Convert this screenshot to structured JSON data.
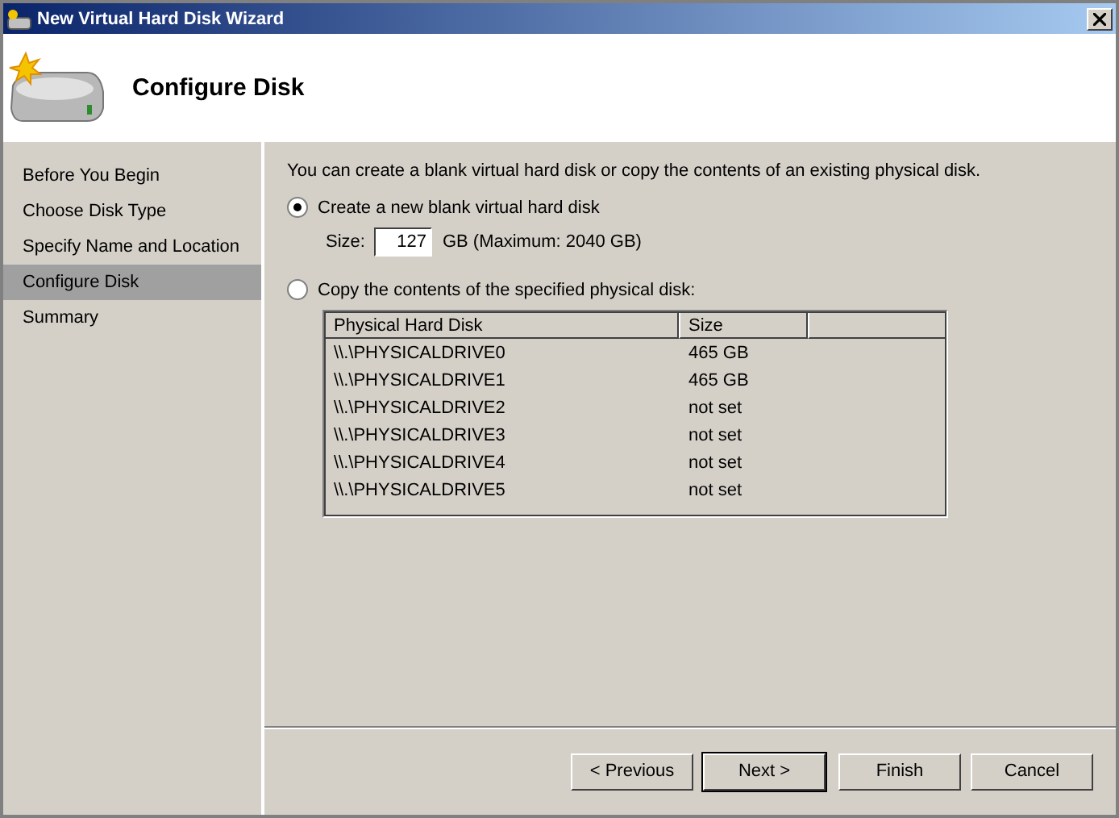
{
  "window": {
    "title": "New Virtual Hard Disk Wizard"
  },
  "header": {
    "title": "Configure Disk"
  },
  "sidebar": {
    "items": [
      {
        "label": "Before You Begin",
        "selected": false
      },
      {
        "label": "Choose Disk Type",
        "selected": false
      },
      {
        "label": "Specify Name and Location",
        "selected": false
      },
      {
        "label": "Configure Disk",
        "selected": true
      },
      {
        "label": "Summary",
        "selected": false
      }
    ]
  },
  "intro": "You can create a blank virtual hard disk or copy the contents of an existing physical disk.",
  "options": [
    {
      "label": "Create a new blank virtual hard disk",
      "selected": true
    },
    {
      "label": "Copy the contents of the specified physical disk:",
      "selected": false
    }
  ],
  "size": {
    "label": "Size:",
    "value": "127",
    "unit": "GB (Maximum: 2040 GB)"
  },
  "table": {
    "columns": [
      "Physical Hard Disk",
      "Size"
    ],
    "rows": [
      [
        "\\\\.\\PHYSICALDRIVE0",
        "465 GB"
      ],
      [
        "\\\\.\\PHYSICALDRIVE1",
        "465 GB"
      ],
      [
        "\\\\.\\PHYSICALDRIVE2",
        "not set"
      ],
      [
        "\\\\.\\PHYSICALDRIVE3",
        "not set"
      ],
      [
        "\\\\.\\PHYSICALDRIVE4",
        "not set"
      ],
      [
        "\\\\.\\PHYSICALDRIVE5",
        "not set"
      ]
    ]
  },
  "buttons": [
    {
      "label": "< Previous",
      "default": false
    },
    {
      "label": "Next >",
      "default": true
    },
    {
      "label": "Finish",
      "default": false
    },
    {
      "label": "Cancel",
      "default": false
    }
  ]
}
